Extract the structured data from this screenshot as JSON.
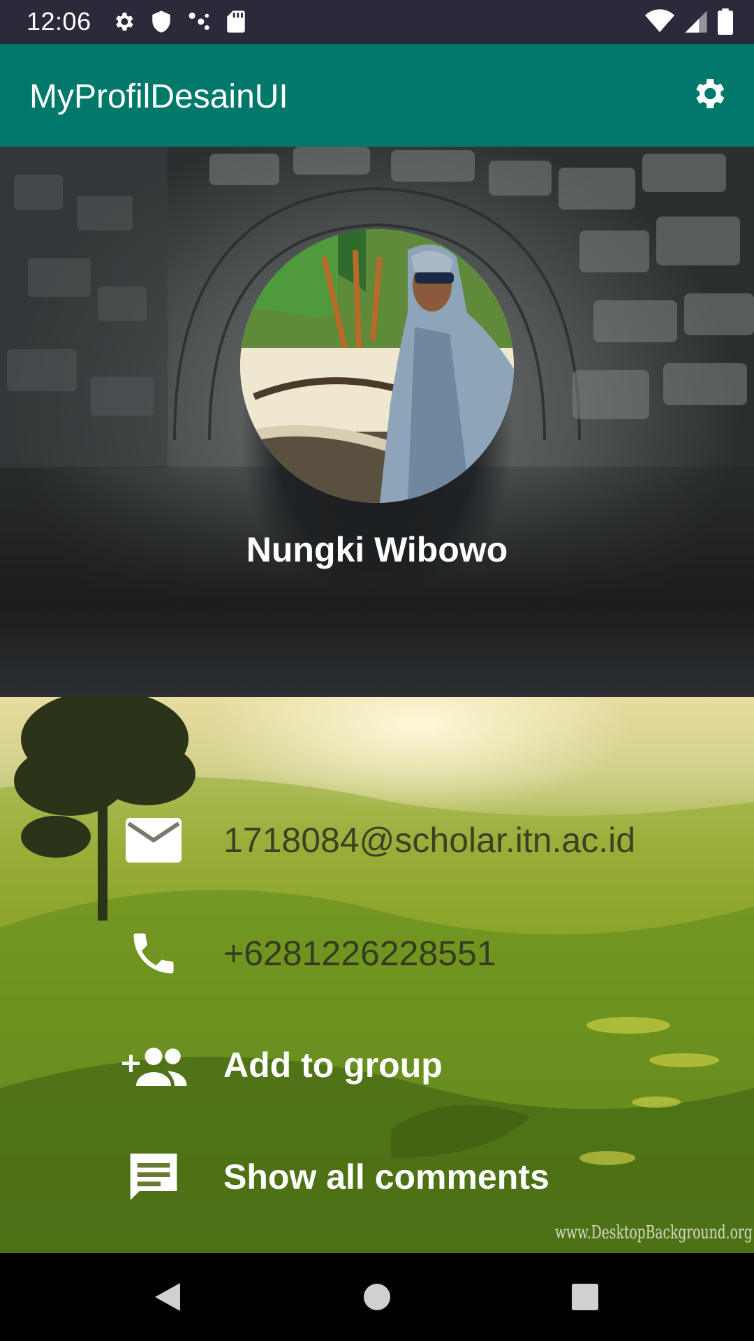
{
  "status_bar": {
    "time": "12:06",
    "icons_left": [
      "gear-icon",
      "shield-icon",
      "dots-icon",
      "sd-card-icon"
    ],
    "icons_right": [
      "wifi-icon",
      "cell-signal-icon",
      "battery-icon"
    ]
  },
  "app_bar": {
    "title": "MyProfilDesainUI",
    "color": "#00796b",
    "action_icon": "settings-icon"
  },
  "profile": {
    "name": "Nungki Wibowo"
  },
  "contact": {
    "email": "1718084@scholar.itn.ac.id",
    "phone": "+6281226228551"
  },
  "actions": {
    "add_to_group": "Add to group",
    "show_comments": "Show all comments"
  },
  "watermark": "www.DesktopBackground.org",
  "nav_bar": {
    "buttons": [
      "back-icon",
      "home-icon",
      "recents-icon"
    ]
  }
}
